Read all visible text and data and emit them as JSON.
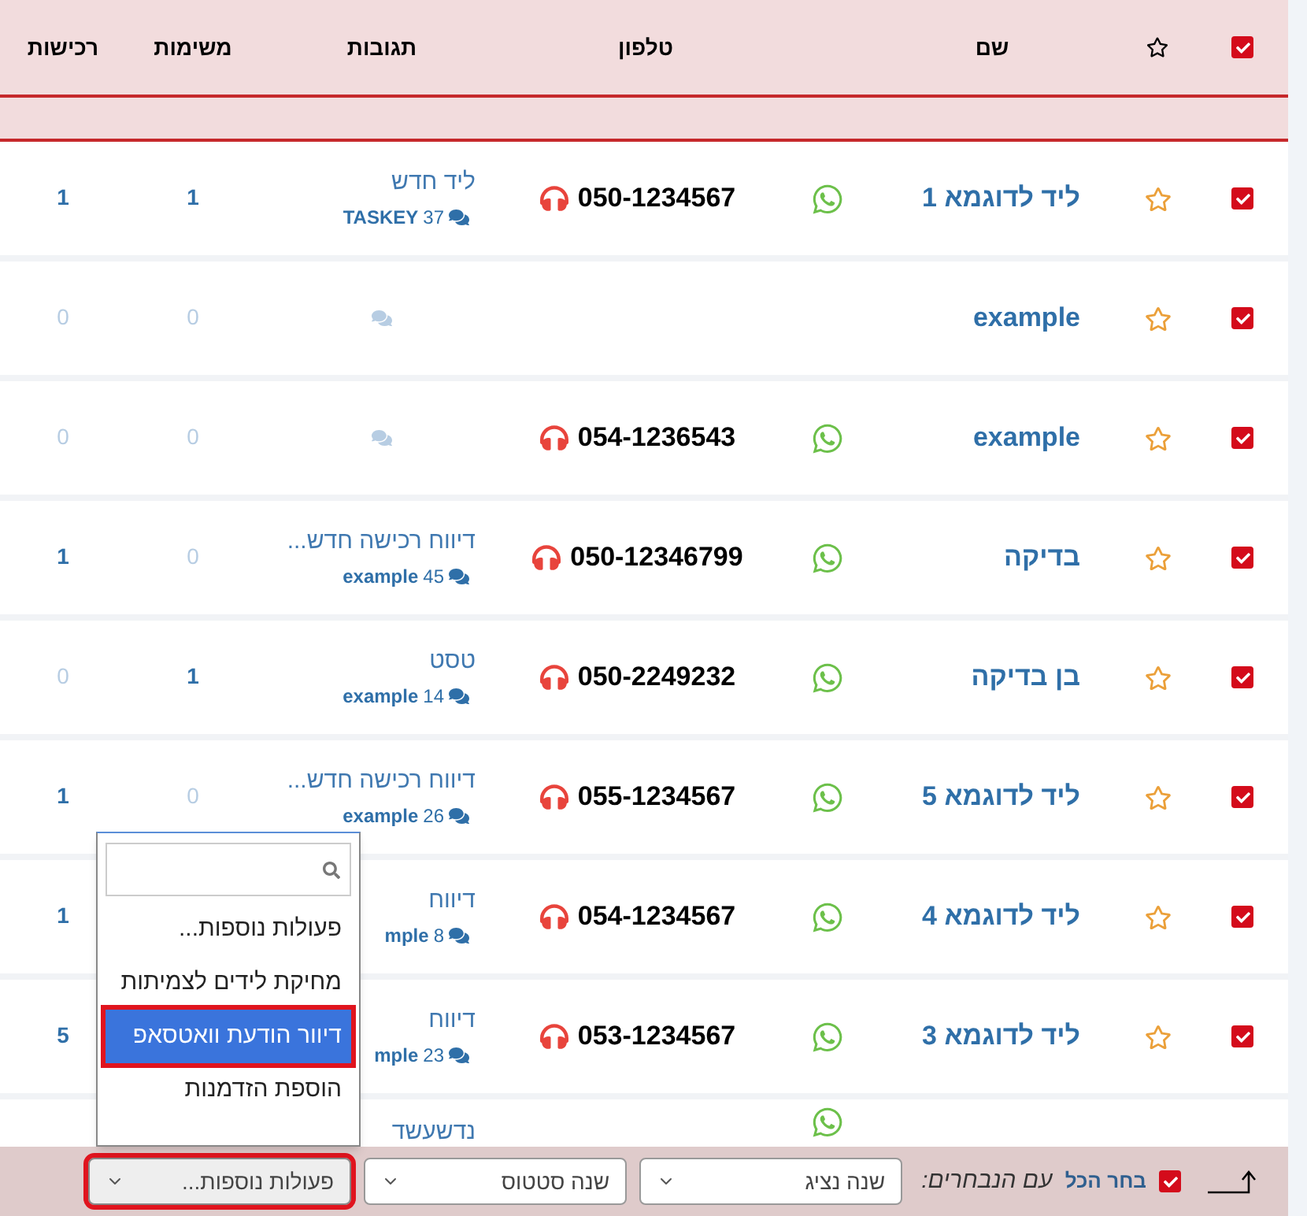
{
  "header": {
    "select_all_checked": true,
    "columns": [
      "שם",
      "טלפון",
      "תגובות",
      "משימות",
      "רכישות"
    ]
  },
  "rows": [
    {
      "checked": true,
      "starred": false,
      "name": "ליד לדוגמא 1",
      "whatsapp": true,
      "phone": "050-1234567",
      "reply": "ליד חדש",
      "reply_count": "37",
      "reply_user": "TASKEY",
      "reply_muted": false,
      "tasks": {
        "text": "1",
        "muted": false
      },
      "purchases": {
        "text": "1",
        "muted": false
      }
    },
    {
      "checked": true,
      "starred": false,
      "name": "example",
      "whatsapp": false,
      "reply_muted": true,
      "tasks": {
        "text": "0",
        "muted": true
      },
      "purchases": {
        "text": "0",
        "muted": true
      }
    },
    {
      "checked": true,
      "starred": false,
      "name": "example",
      "whatsapp": true,
      "phone": "054-1236543",
      "reply_muted": true,
      "tasks": {
        "text": "0",
        "muted": true
      },
      "purchases": {
        "text": "0",
        "muted": true
      }
    },
    {
      "checked": true,
      "starred": false,
      "name": "בדיקה",
      "whatsapp": true,
      "phone": "050-12346799",
      "reply": "דיווח רכישה חדש...",
      "reply_count": "45",
      "reply_user": "example",
      "reply_muted": false,
      "tasks": {
        "text": "0",
        "muted": true
      },
      "purchases": {
        "text": "1",
        "muted": false
      }
    },
    {
      "checked": true,
      "starred": false,
      "name": "בן בדיקה",
      "whatsapp": true,
      "phone": "050-2249232",
      "reply": "טסט",
      "reply_count": "14",
      "reply_user": "example",
      "reply_muted": false,
      "tasks": {
        "text": "1",
        "muted": false
      },
      "purchases": {
        "text": "0",
        "muted": true
      }
    },
    {
      "checked": true,
      "starred": false,
      "name": "ליד לדוגמא 5",
      "whatsapp": true,
      "phone": "055-1234567",
      "reply": "דיווח רכישה חדש...",
      "reply_count": "26",
      "reply_user": "example",
      "reply_muted": false,
      "tasks": {
        "text": "0",
        "muted": true
      },
      "purchases": {
        "text": "1",
        "muted": false
      }
    },
    {
      "checked": true,
      "starred": false,
      "name": "ליד לדוגמא 4",
      "whatsapp": true,
      "phone": "054-1234567",
      "reply": "דיווח",
      "reply_count": "8",
      "reply_user": "mple",
      "reply_muted": false,
      "purchases": {
        "text": "1",
        "muted": false
      }
    },
    {
      "checked": true,
      "starred": false,
      "name": "ליד לדוגמא 3",
      "whatsapp": true,
      "phone": "053-1234567",
      "reply": "דיווח",
      "reply_count": "23",
      "reply_user": "mple",
      "reply_muted": false,
      "purchases": {
        "text": "5",
        "muted": false
      }
    },
    {
      "whatsapp": true,
      "reply": "נדשעשד"
    }
  ],
  "dropdown": {
    "options": [
      {
        "label": "פעולות נוספות...",
        "selected": false
      },
      {
        "label": "מחיקת לידים לצמיתות",
        "selected": false
      },
      {
        "label": "דיוור הודעת וואטסאפ",
        "selected": true
      },
      {
        "label": "הוספת הזדמנות",
        "selected": false
      }
    ]
  },
  "footer": {
    "select_all_checked": true,
    "select_all": "בחר הכל",
    "with_selected": "עם הנבחרים:",
    "selects": [
      {
        "value": "שנה נציג",
        "open": false
      },
      {
        "value": "שנה סטטוס",
        "open": false
      },
      {
        "value": "פעולות נוספות...",
        "open": true
      }
    ]
  }
}
